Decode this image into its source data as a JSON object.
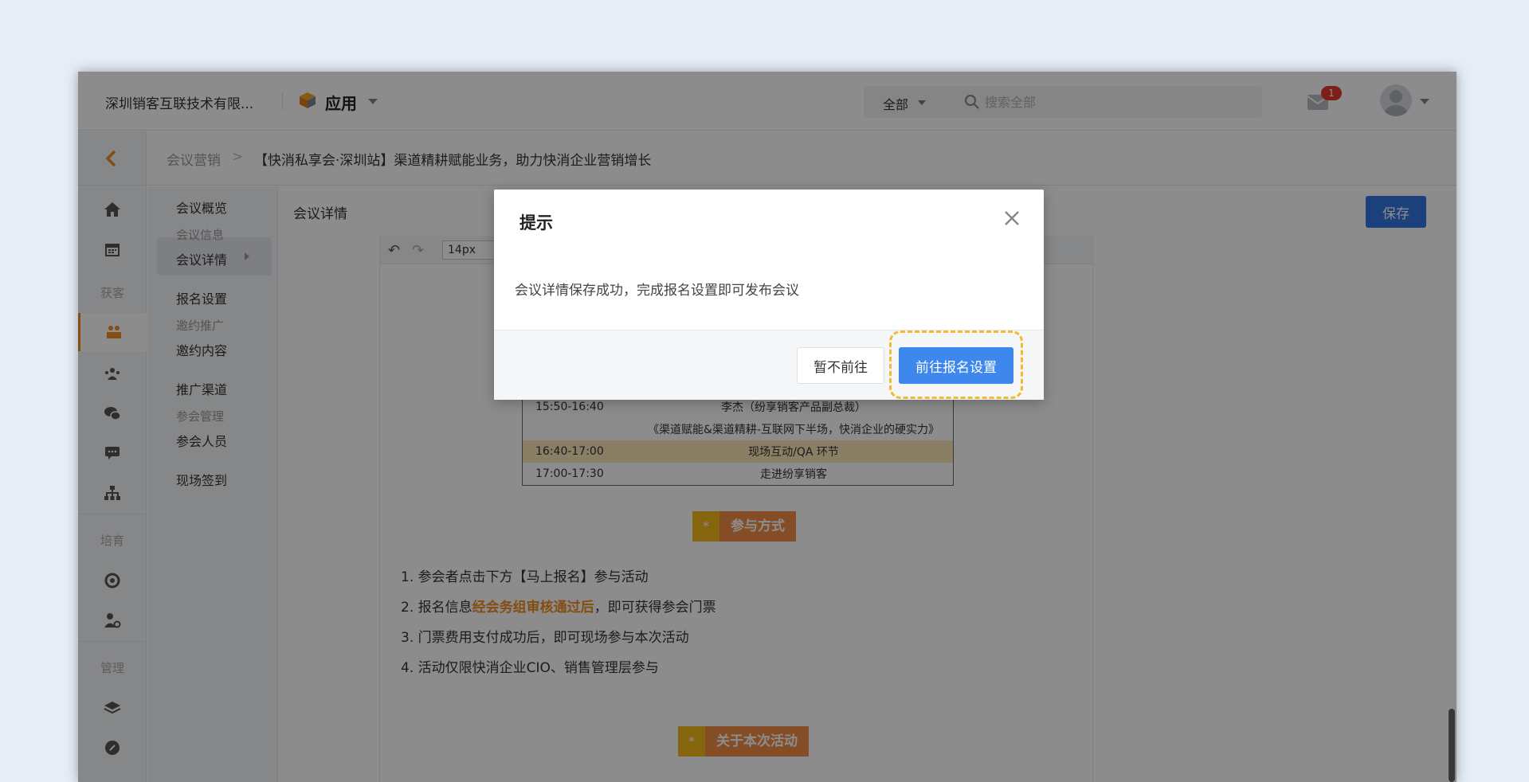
{
  "topbar": {
    "company": "深圳销客互联技术有限...",
    "app_label": "应用",
    "search_scope": "全部",
    "search_placeholder": "搜索全部",
    "mail_badge": "1"
  },
  "breadcrumb": {
    "parent": "会议营销",
    "separator": ">",
    "current": "【快消私享会·深圳站】渠道精耕赋能业务，助力快消企业营销增长"
  },
  "rail": {
    "groups": [
      "获客",
      "培育",
      "管理"
    ]
  },
  "subnav": {
    "items": [
      "会议概览",
      "会议信息",
      "会议详情",
      "报名设置",
      "邀约推广",
      "邀约内容",
      "推广渠道",
      "参会管理",
      "参会人员",
      "现场签到"
    ]
  },
  "main": {
    "title": "会议详情",
    "save_label": "保存",
    "font_size": "14px"
  },
  "agenda": [
    {
      "time": "15:50-16:40",
      "desc": "李杰（纷享销客产品副总裁）",
      "hl": false
    },
    {
      "time": "",
      "desc": "《渠道赋能&渠道精耕-互联网下半场，快消企业的硬实力》",
      "hl": false
    },
    {
      "time": "16:40-17:00",
      "desc": "现场互动/QA 环节",
      "hl": true
    },
    {
      "time": "17:00-17:30",
      "desc": "走进纷享销客",
      "hl": false
    }
  ],
  "sections": {
    "star": "*",
    "participate": "参与方式",
    "about": "关于本次活动"
  },
  "steps": {
    "s1": "1. 参会者点击下方【马上报名】参与活动",
    "s2_pre": "2. 报名信息",
    "s2_strong": "经会务组审核通过后",
    "s2_post": "，即可获得参会门票",
    "s3": "3. 门票费用支付成功后，即可现场参与本次活动",
    "s4": "4. 活动仅限快消企业CIO、销售管理层参与"
  },
  "dialog": {
    "title": "提示",
    "message": "会议详情保存成功，完成报名设置即可发布会议",
    "cancel_label": "暂不前往",
    "confirm_label": "前往报名设置"
  },
  "colors": {
    "primary": "#3e87ec",
    "accent": "#f08c20",
    "highlight_ring": "#f5b82e"
  }
}
